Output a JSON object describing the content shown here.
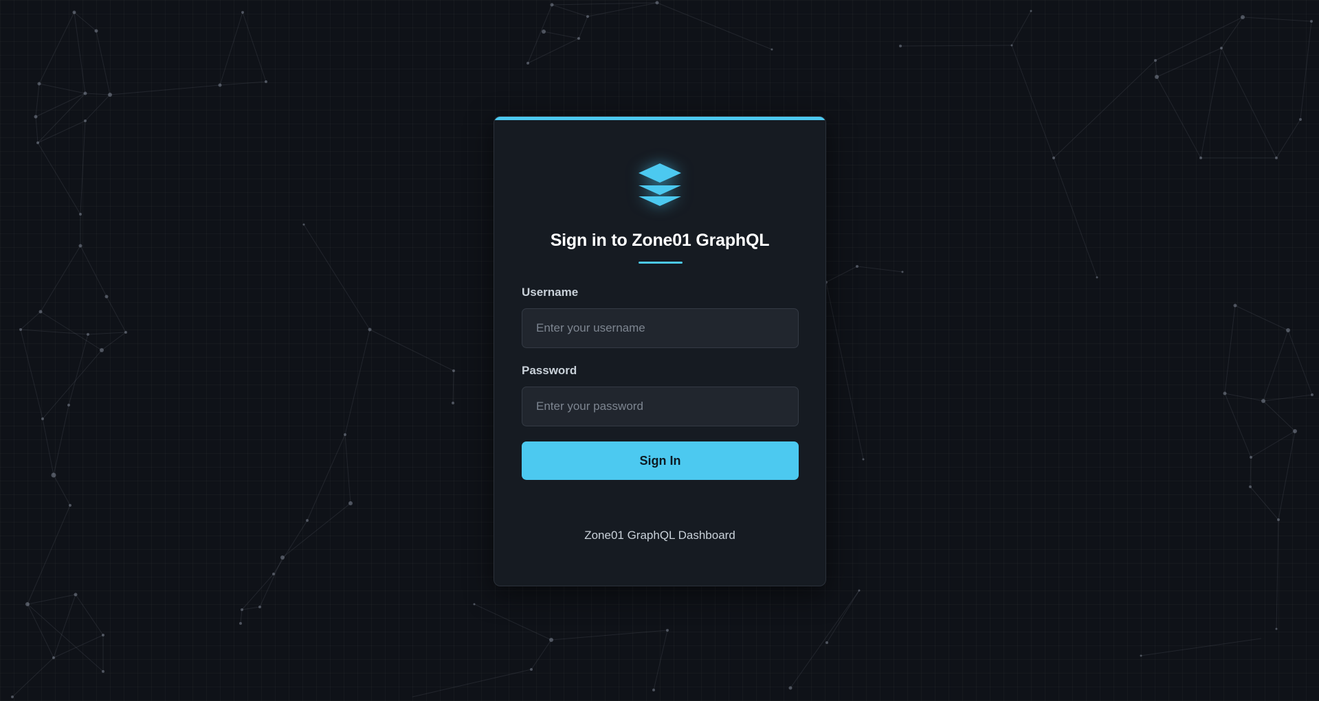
{
  "login": {
    "title": "Sign in to Zone01 GraphQL",
    "username_label": "Username",
    "username_placeholder": "Enter your username",
    "username_value": "",
    "password_label": "Password",
    "password_placeholder": "Enter your password",
    "password_value": "",
    "submit_label": "Sign In",
    "footer": "Zone01 GraphQL Dashboard",
    "logo_icon": "layers-icon"
  },
  "theme": {
    "accent": "#4cc9f0",
    "background": "#0f1218",
    "card": "#161b22"
  }
}
